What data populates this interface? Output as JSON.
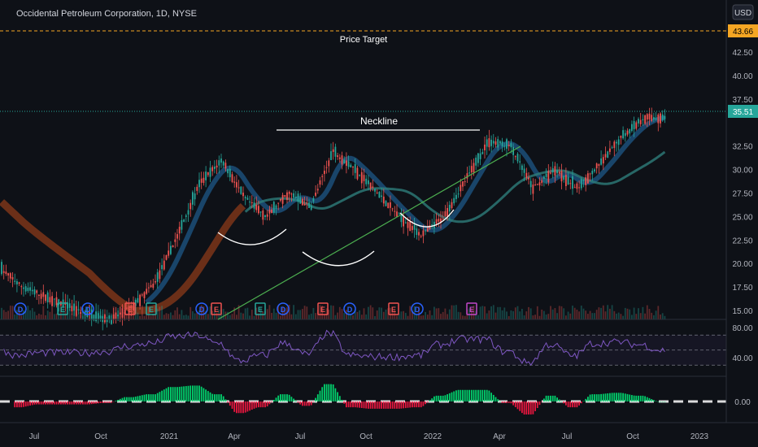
{
  "header": {
    "symbol_title": "Occidental Petroleum Corporation, 1D, NYSE",
    "currency_label": "USD"
  },
  "annotations": {
    "price_target_label": "Price Target",
    "neckline_label": "Neckline"
  },
  "price_badges": {
    "target": "43.66",
    "last": "35.51"
  },
  "colors": {
    "background": "#0e1117",
    "up_candle": "#26a69a",
    "down_candle": "#ef5350",
    "trendline": "#4caf50",
    "price_target_line": "#f5a623",
    "rsi_line": "#7e57c2",
    "dividend_marker": "#2962ff",
    "earnings_marker": "#ef5350",
    "ma_long": "#8b3a1a"
  },
  "chart_data": {
    "type": "candlestick",
    "symbol": "Occidental Petroleum Corporation, 1D, NYSE",
    "x_labels": [
      "Jul",
      "Oct",
      "2021",
      "Apr",
      "Jul",
      "Oct",
      "2022",
      "Apr",
      "Jul",
      "Oct",
      "2023"
    ],
    "y_ticks": [
      "42.50",
      "40.00",
      "37.50",
      "32.50",
      "30.00",
      "27.50",
      "25.00",
      "22.50",
      "20.00",
      "17.50",
      "15.00"
    ],
    "ylim": [
      14.5,
      45
    ],
    "price_series": {
      "months": [
        0,
        1,
        2,
        3,
        4,
        5,
        6,
        7,
        8,
        9,
        10,
        11,
        12,
        13,
        14,
        15,
        16,
        17,
        18,
        19,
        20,
        21,
        22,
        23,
        24,
        25,
        26,
        27,
        28,
        29,
        30
      ],
      "close": [
        19.5,
        17.5,
        16.5,
        15.5,
        14.5,
        14.0,
        15.5,
        18.0,
        23.0,
        28.5,
        31.0,
        27.0,
        25.0,
        27.5,
        26.0,
        32.0,
        30.0,
        27.5,
        25.0,
        23.0,
        25.0,
        29.0,
        33.0,
        32.5,
        28.0,
        30.0,
        28.0,
        30.5,
        33.5,
        35.5,
        35.5
      ]
    },
    "event_markers": {
      "labels": [
        "D",
        "E",
        "D",
        "E",
        "E",
        "D",
        "E",
        "E",
        "D",
        "E",
        "D",
        "E",
        "D",
        "E"
      ]
    },
    "rsi": {
      "y_ticks": [
        "80.00",
        "40.00"
      ],
      "ylim": [
        20,
        90
      ]
    },
    "macd": {
      "y_ticks": [
        "0.00"
      ]
    }
  }
}
